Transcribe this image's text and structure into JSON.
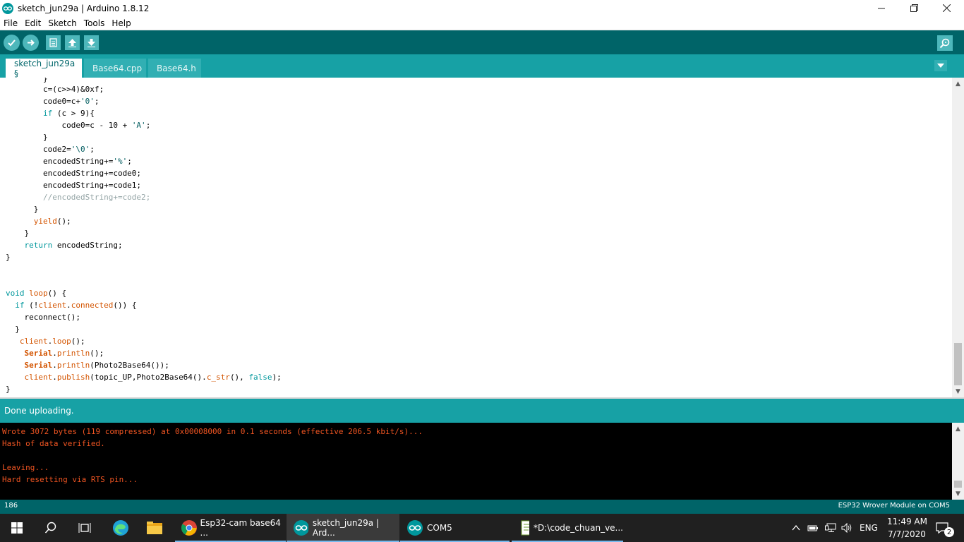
{
  "window": {
    "title": "sketch_jun29a | Arduino 1.8.12",
    "controls": [
      "minimize",
      "maximize",
      "close"
    ]
  },
  "menu": [
    "File",
    "Edit",
    "Sketch",
    "Tools",
    "Help"
  ],
  "toolbar": {
    "buttons": [
      "verify",
      "upload",
      "new",
      "open",
      "save"
    ],
    "serial_monitor": "serial-monitor"
  },
  "tabs": [
    {
      "label": "sketch_jun29a §",
      "active": true
    },
    {
      "label": "Base64.cpp",
      "active": false
    },
    {
      "label": "Base64.h",
      "active": false
    }
  ],
  "code_lines": [
    "        }",
    "        c=(c>>4)&0xf;",
    "        code0=c+'0';",
    "        if (c > 9){",
    "            code0=c - 10 + 'A';",
    "        }",
    "        code2='\\0';",
    "        encodedString+='%';",
    "        encodedString+=code0;",
    "        encodedString+=code1;",
    "        //encodedString+=code2;",
    "      }",
    "      yield();",
    "    }",
    "    return encodedString;",
    "}",
    "",
    "",
    "void loop() {",
    "  if (!client.connected()) {",
    "    reconnect();",
    "  }",
    "   client.loop();",
    "    Serial.println();",
    "    Serial.println(Photo2Base64());",
    "    client.publish(topic_UP,Photo2Base64().c_str(), false);",
    "}"
  ],
  "status": {
    "message": "Done uploading."
  },
  "console_lines": [
    "Wrote 3072 bytes (119 compressed) at 0x00008000 in 0.1 seconds (effective 206.5 kbit/s)...",
    "Hash of data verified.",
    "",
    "Leaving...",
    "Hard resetting via RTS pin..."
  ],
  "bottom": {
    "line_number": "186",
    "board": "ESP32 Wrover Module on COM5"
  },
  "taskbar": {
    "apps": [
      {
        "label": "Esp32-cam base64 ...",
        "active": false
      },
      {
        "label": "sketch_jun29a | Ard...",
        "active": true
      },
      {
        "label": "COM5",
        "active": false
      },
      {
        "label": "*D:\\code_chuan_ve...",
        "active": false
      }
    ],
    "language": "ENG",
    "time": "11:49 AM",
    "date": "7/7/2020",
    "notifications": "2"
  },
  "colors": {
    "toolbar": "#006468",
    "tabbar": "#17a1a5",
    "console_text": "#f05522"
  }
}
